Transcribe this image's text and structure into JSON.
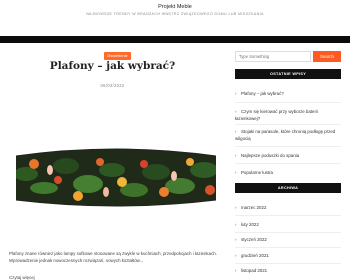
{
  "header": {
    "site_title": "Projekt Meble",
    "tagline": "NAJNOWSZE TRENDY W BRANŻACH WNĘTRZ ZWIĄZKOWEGO DOMU LUB MIESZKANIA"
  },
  "post": {
    "category": "Oświetlenie",
    "title": "Plafony – jak wybrać?",
    "date": "06/03/2022",
    "excerpt": "Plafony znane również jako lampy sufitowe stosowane są zwykle w kuchniach, przedpokojach i łazienkach. Wprowadzenie jednak nowoczesnych rozwiązań, nowych kształtów...",
    "read_more": "Czytaj więcej"
  },
  "sidebar": {
    "search_placeholder": "Type Something",
    "search_button": "Search",
    "recent_title": "OSTATNIE WPISY",
    "recent_posts": [
      "Plafony – jak wybrać?",
      "Czym się kierować przy wyborze baterii łazienkowej?",
      "Stojaki na parasole, które chronią podłogę przed wilgocią",
      "Najlepsze poduszki do spania",
      "Popularne lustra"
    ],
    "archive_title": "ARCHIWA",
    "archives": [
      "marzec 2022",
      "luty 2022",
      "styczeń 2022",
      "grudzień 2021",
      "listopad 2021"
    ]
  },
  "colors": {
    "accent": "#ff5a1f",
    "navbar": "#0b0b0b",
    "widget_title_bg": "#111111"
  }
}
